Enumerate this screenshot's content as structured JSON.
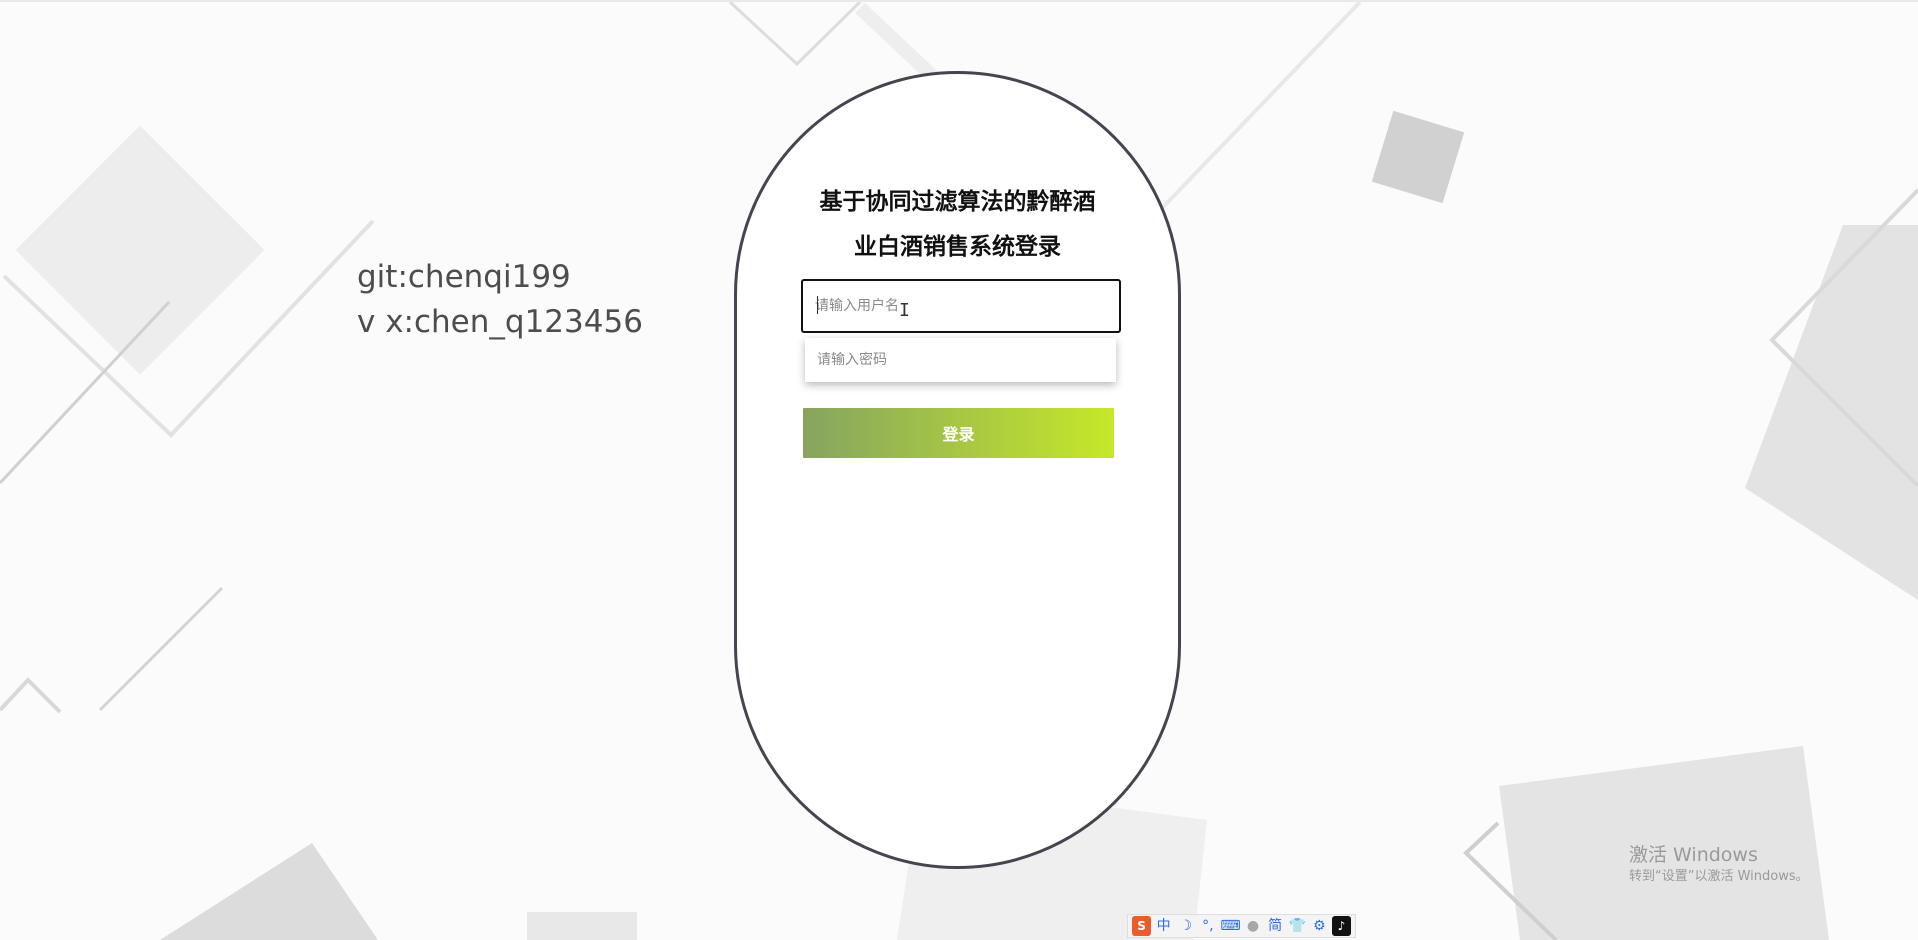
{
  "credits": {
    "line1": "git:chenqi199",
    "line2": "v x:chen_q123456"
  },
  "login": {
    "title_line1": "基于协同过滤算法的黔醉酒",
    "title_line2": "业白酒销售系统登录",
    "username_placeholder": "请输入用户名",
    "password_placeholder": "请输入密码",
    "login_button": "登录"
  },
  "watermark": {
    "title": "激活 Windows",
    "subtitle": "转到“设置”以激活 Windows。"
  },
  "ime_toolbar": {
    "items": [
      {
        "name": "sogou-logo-icon",
        "glyph": "S"
      },
      {
        "name": "chinese-mode-icon",
        "glyph": "中"
      },
      {
        "name": "moon-icon",
        "glyph": "☽"
      },
      {
        "name": "punctuation-icon",
        "glyph": "°,"
      },
      {
        "name": "keyboard-icon",
        "glyph": "⌨"
      },
      {
        "name": "user-icon",
        "glyph": "●"
      },
      {
        "name": "simplified-icon",
        "glyph": "简"
      },
      {
        "name": "skin-shirt-icon",
        "glyph": "👕"
      },
      {
        "name": "settings-gear-icon",
        "glyph": "⚙"
      },
      {
        "name": "tiktok-icon",
        "glyph": "♪"
      }
    ]
  },
  "colors": {
    "card_border": "#44454f",
    "button_start": "#86a460",
    "button_end": "#c6e829",
    "background": "#fbfbfb"
  }
}
